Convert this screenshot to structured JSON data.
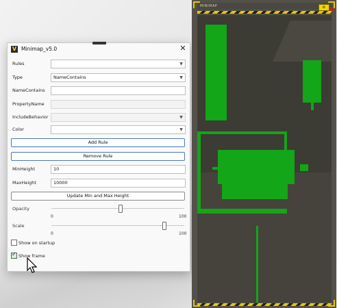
{
  "dialog": {
    "title": "Minimap_v5.0",
    "app_icon": "V",
    "close_icon": "✕",
    "fields": {
      "rules": {
        "label": "Rules",
        "value": ""
      },
      "type": {
        "label": "Type",
        "value": "NameContains"
      },
      "name_contains": {
        "label": "NameContains",
        "value": ""
      },
      "property_name": {
        "label": "PropertyName",
        "value": ""
      },
      "include_behavior": {
        "label": "IncludeBehavior",
        "value": ""
      },
      "color": {
        "label": "Color",
        "value": ""
      },
      "min_height": {
        "label": "MinHeight",
        "value": "10"
      },
      "max_height": {
        "label": "MaxHeight",
        "value": "10000"
      }
    },
    "buttons": {
      "add_rule": "Add Rule",
      "remove_rule": "Remove Rule",
      "update_min_max": "Update Min and Max Height"
    },
    "opacity": {
      "label": "Opacity",
      "min": "0",
      "max": "100",
      "value": 0.52
    },
    "scale": {
      "label": "Scale",
      "min": "0",
      "max": "100",
      "value": 0.86
    },
    "checkboxes": {
      "show_on_startup": {
        "label": "Show on startup",
        "checked": false
      },
      "show_frame": {
        "label": "Show frame",
        "checked": true
      }
    }
  },
  "minimap": {
    "title_text": "MINIMAP",
    "button_icon": "gear-icon",
    "close_icon": "close-icon",
    "accent_color": "#e8c600",
    "object_color": "#12a618"
  }
}
